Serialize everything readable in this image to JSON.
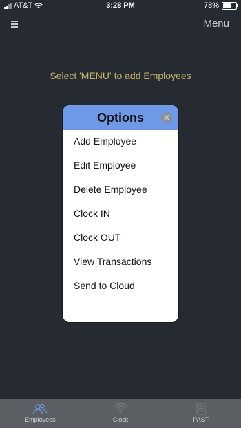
{
  "status": {
    "carrier": "AT&T",
    "time": "3:28 PM",
    "battery": "78%",
    "battery_level": 0.78
  },
  "navbar": {
    "menu_label": "Menu"
  },
  "main": {
    "hint": "Select 'MENU' to add Employees"
  },
  "dialog": {
    "title": "Options",
    "close_icon": "close-icon",
    "options": [
      {
        "label": "Add Employee"
      },
      {
        "label": "Edit Employee"
      },
      {
        "label": "Delete Employee"
      },
      {
        "label": "Clock IN"
      },
      {
        "label": "Clock OUT"
      },
      {
        "label": "View Transactions"
      },
      {
        "label": "Send to Cloud"
      }
    ]
  },
  "tabbar": {
    "tabs": [
      {
        "label": "Employees",
        "icon": "employees-icon"
      },
      {
        "label": "Clock",
        "icon": "clock-icon"
      },
      {
        "label": "PAST",
        "icon": "past-icon"
      }
    ]
  },
  "colors": {
    "background": "#262a31",
    "dialog_header": "#6f98e6",
    "hint_text": "#c6b56a",
    "tabbar": "#5b5e63"
  }
}
